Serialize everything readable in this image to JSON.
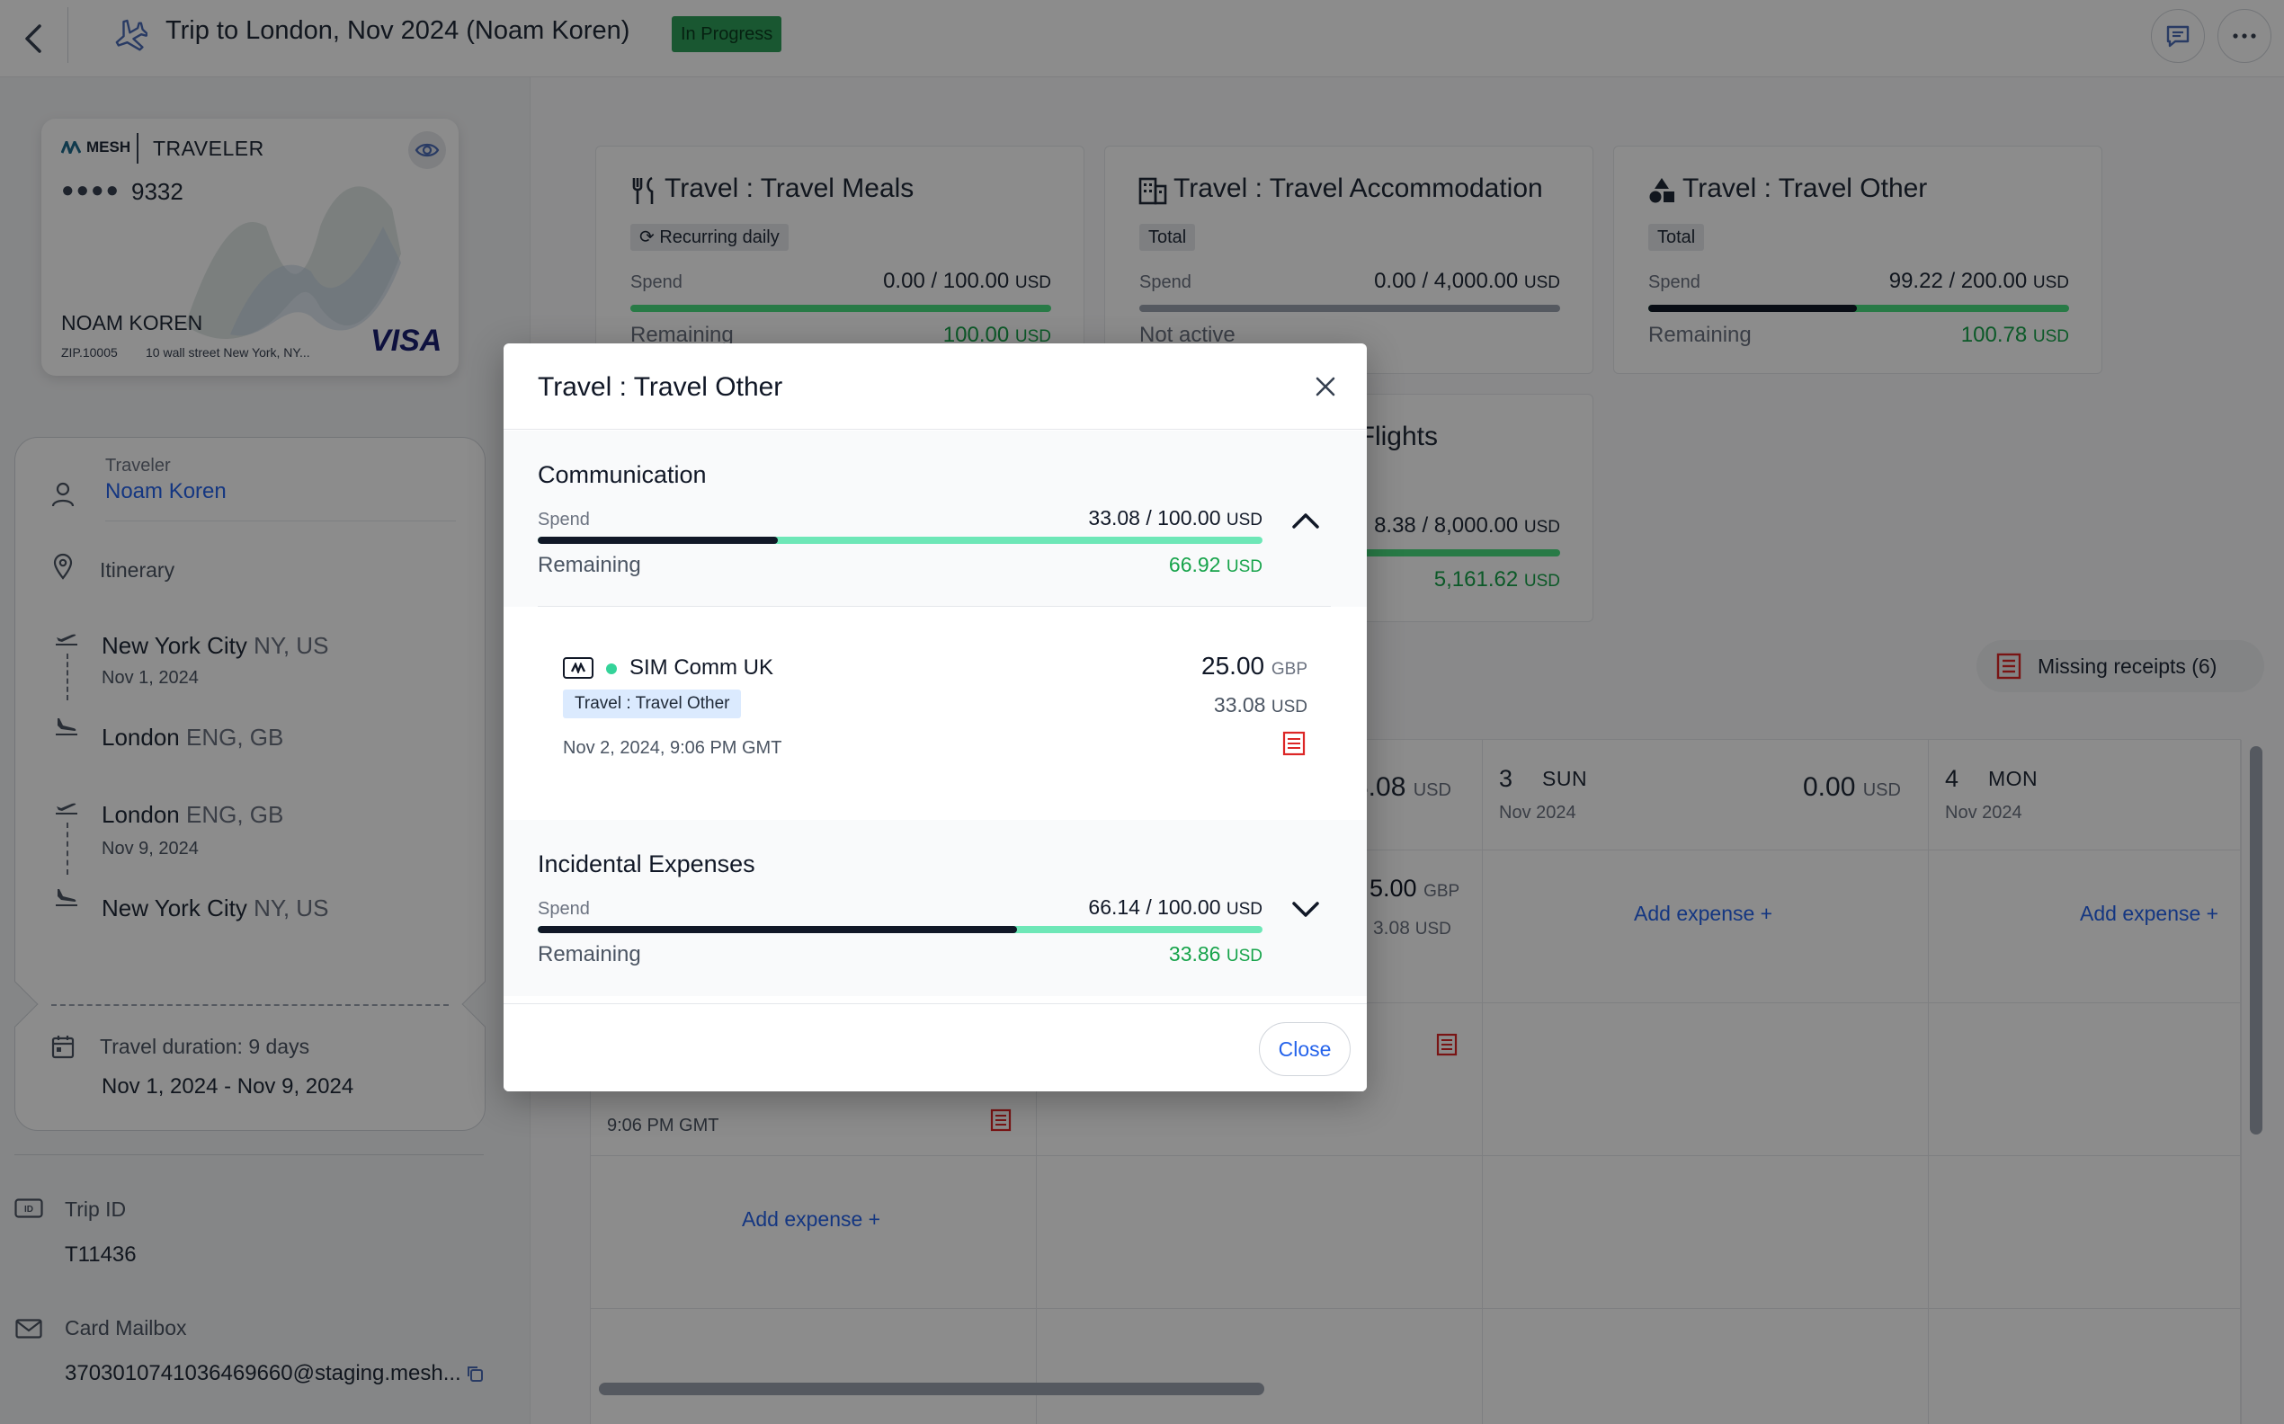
{
  "header": {
    "title": "Trip to London, Nov 2024 (Noam Koren)",
    "status": "In Progress"
  },
  "card": {
    "brand": "MESH",
    "type": "TRAVELER",
    "dots": "●●●●",
    "last4": "9332",
    "holder": "NOAM KOREN",
    "zip": "ZIP.10005",
    "address": "10 wall street New York, NY...",
    "network": "VISA"
  },
  "traveler": {
    "label": "Traveler",
    "name": "Noam Koren"
  },
  "itinerary": {
    "label": "Itinerary",
    "legs": [
      {
        "dep_city": "New York City",
        "dep_region": "NY, US",
        "date": "Nov 1, 2024",
        "arr_city": "London",
        "arr_region": "ENG, GB"
      },
      {
        "dep_city": "London",
        "dep_region": "ENG, GB",
        "date": "Nov 9, 2024",
        "arr_city": "New York City",
        "arr_region": "NY, US"
      }
    ]
  },
  "duration": {
    "label": "Travel duration: 9 days",
    "range": "Nov 1, 2024 - Nov 9, 2024"
  },
  "trip_id": {
    "label": "Trip ID",
    "value": "T11436"
  },
  "mailbox": {
    "label": "Card Mailbox",
    "value": "370301074103646966­0@staging.mesh..."
  },
  "budgets": [
    {
      "title": "Travel : Travel Meals",
      "tag": "Recurring daily",
      "spend_label": "Spend",
      "spend": "0.00 / 100.00",
      "currency": "USD",
      "remaining_label": "Remaining",
      "remaining": "100.00",
      "spent_fraction": 0.0
    },
    {
      "title": "Travel : Travel Accommodation",
      "tag": "Total",
      "spend_label": "Spend",
      "spend": "0.00 / 4,000.00",
      "currency": "USD",
      "remaining_label": "Not active",
      "spent_fraction": 0.0
    },
    {
      "title": "Travel : Travel Other",
      "tag": "Total",
      "spend_label": "Spend",
      "spend": "99.22 / 200.00",
      "currency": "USD",
      "remaining_label": "Remaining",
      "remaining": "100.78",
      "spent_fraction": 0.496
    },
    {
      "title": "Flights",
      "spend": "8.38 / 8,000.00",
      "currency": "USD",
      "remaining": "5,161.62"
    }
  ],
  "missing_receipts": "Missing receipts (6)",
  "calendar": {
    "partial_total": "8.08",
    "partial_currency": "USD",
    "partial_amt": "5.00",
    "partial_amt_cur": "GBP",
    "partial_amt2": "3.08",
    "partial_amt2_cur": "USD",
    "first_time": "9:06 PM GMT",
    "add_expense": "Add expense +",
    "days": [
      {
        "num": "3",
        "name": "SUN",
        "month": "Nov 2024",
        "total": "0.00",
        "currency": "USD"
      },
      {
        "num": "4",
        "name": "MON",
        "month": "Nov 2024"
      }
    ]
  },
  "modal": {
    "title": "Travel : Travel Other",
    "close_label": "Close",
    "sections": [
      {
        "title": "Communication",
        "spend_label": "Spend",
        "spend": "33.08 / 100.00",
        "currency": "USD",
        "remaining_label": "Remaining",
        "remaining": "66.92",
        "spent_fraction": 0.331,
        "expanded": true
      },
      {
        "title": "Incidental Expenses",
        "spend_label": "Spend",
        "spend": "66.14 / 100.00",
        "currency": "USD",
        "remaining_label": "Remaining",
        "remaining": "33.86",
        "spent_fraction": 0.661,
        "expanded": false
      }
    ],
    "transaction": {
      "merchant": "SIM Comm UK",
      "category": "Travel : Travel Other",
      "date": "Nov 2, 2024, 9:06 PM GMT",
      "amount": "25.00",
      "amount_currency": "GBP",
      "converted": "33.08",
      "converted_currency": "USD"
    }
  }
}
